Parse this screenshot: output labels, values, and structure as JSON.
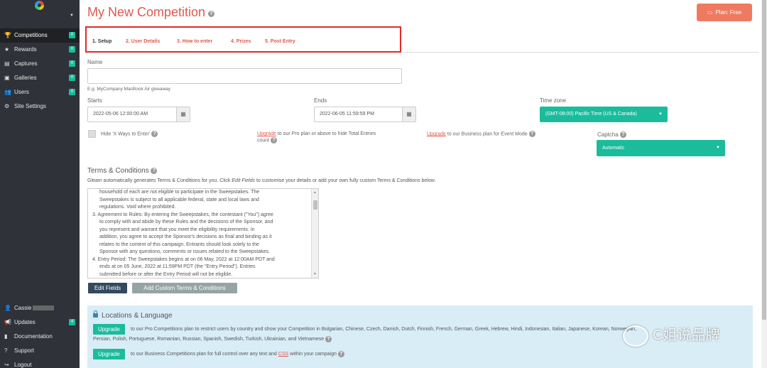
{
  "sidebar": {
    "account_name": "",
    "items": [
      {
        "icon": "trophy-icon",
        "glyph": "🏆",
        "label": "Competitions",
        "count": "0"
      },
      {
        "icon": "star-icon",
        "glyph": "★",
        "label": "Rewards",
        "count": "0"
      },
      {
        "icon": "captures-icon",
        "glyph": "▤",
        "label": "Captures",
        "count": "0"
      },
      {
        "icon": "galleries-icon",
        "glyph": "▣",
        "label": "Galleries",
        "count": "0"
      },
      {
        "icon": "users-icon",
        "glyph": "👥",
        "label": "Users",
        "count": "0"
      },
      {
        "icon": "gear-icon",
        "glyph": "⚙",
        "label": "Site Settings",
        "count": ""
      }
    ],
    "bottom_items": [
      {
        "icon": "user-icon",
        "glyph": "👤",
        "label": "Cassie",
        "count": ""
      },
      {
        "icon": "megaphone-icon",
        "glyph": "📢",
        "label": "Updates",
        "count": "4"
      },
      {
        "icon": "book-icon",
        "glyph": "▮",
        "label": "Documentation",
        "count": ""
      },
      {
        "icon": "help-icon",
        "glyph": "?",
        "label": "Support",
        "count": ""
      },
      {
        "icon": "logout-icon",
        "glyph": "↪",
        "label": "Logout",
        "count": ""
      }
    ]
  },
  "header": {
    "title": "My New Competition",
    "plan_button": "Plan: Free"
  },
  "tabs": [
    "1. Setup",
    "2. User Details",
    "3. How to enter",
    "4. Prizes",
    "5. Post Entry"
  ],
  "form": {
    "name_label": "Name",
    "name_value": "",
    "name_hint": "E.g. MyCompany MacBook Air giveaway",
    "starts_label": "Starts",
    "starts_value": "2022-05-06 12:00:00 AM",
    "ends_label": "Ends",
    "ends_value": "2022-06-05 11:59:59 PM",
    "timezone_label": "Time zone",
    "timezone_value": "(GMT-08:00) Pacific Time (US & Canada)",
    "hide_ways_label": "Hide 'X Ways to Enter'",
    "upgrade_link": "Upgrade",
    "hide_total_text": "to our Pro plan or above to hide Total Entries",
    "hide_total_count": "count",
    "event_mode_text": "to our Business plan for Event Mode",
    "captcha_label": "Captcha",
    "captcha_value": "Automatic"
  },
  "terms": {
    "title": "Terms & Conditions",
    "desc_pre": "Gleam automatically generates Terms & Conditions for you. Click ",
    "desc_em": "Edit Fields",
    "desc_post": " to customise your details or add your own fully custom Terms & Conditions below.",
    "lines": [
      "household of each are not eligible to participate in the Sweepstakes. The",
      "Sweepstakes is subject to all applicable federal, state and local laws and",
      "regulations. Void where prohibited.",
      "3. Agreement to Rules: By entering the Sweepstakes, the contestant (\"You\") agree",
      "to comply with and abide by these Rules and the decisions of the Sponsor, and",
      "you represent and warrant that you meet the eligibility requirements. In",
      "addition, you agree to accept the Sponsor's decisions as final and binding as it",
      "relates to the content of this campaign. Entrants should look solely to the",
      "Sponsor with any questions, comments or issues related to the Sweepstakes.",
      "4. Entry Period: The Sweepstakes begins at on 06 May, 2022 at 12:00AM PDT and",
      "ends at on 05 June, 2022 at 11:59PM PDT (the \"Entry Period\"). Entries",
      "submitted before or after the Entry Period will not be eligible."
    ],
    "edit_fields_button": "Edit Fields",
    "add_custom_button": "Add Custom Terms & Conditions"
  },
  "locations": {
    "title": "Locations & Language",
    "upgrade_button": "Upgrade",
    "pro_text": "to our Pro Competitions plan to restrict users by country and show your Competition in Bulgarian, Chinese, Czech, Danish, Dutch, Finnish, French, German, Greek, Hebrew, Hindi, Indonesian, Italian, Japanese, Korean, Norwegian,",
    "pro_text_2": "Persian, Polish, Portuguese, Romanian, Russian, Spanish, Swedish, Turkish, Ukrainian, and Vietnamese",
    "business_text_pre": "to our Business Competitions plan for full control over any text and ",
    "business_link": "CSS",
    "business_text_post": " within your campaign"
  },
  "watermark": "C姐说品牌",
  "colors": {
    "accent_red": "#e05a4d",
    "plan_button": "#ef7a5f",
    "green": "#1abc9c",
    "sidebar": "#2f3238"
  }
}
